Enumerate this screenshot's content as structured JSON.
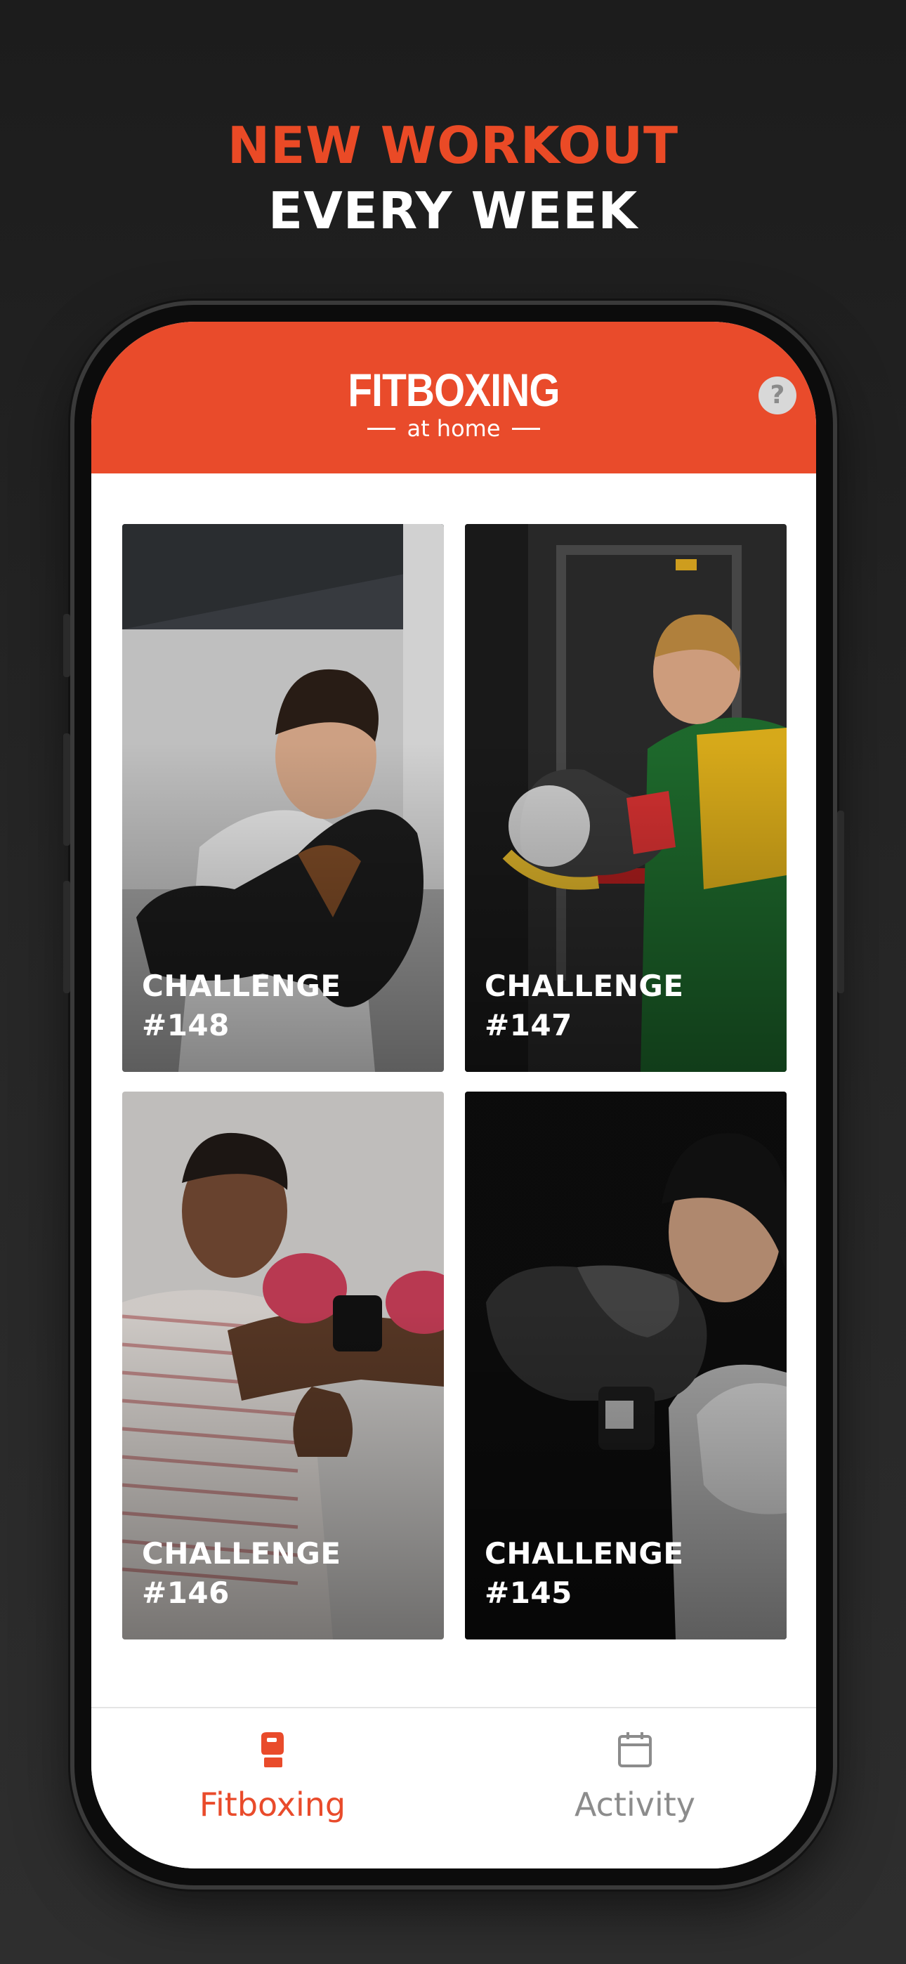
{
  "promo": {
    "headline_line1": "NEW WORKOUT",
    "headline_line2": "EVERY WEEK"
  },
  "app": {
    "logo_main": "FITBOXING",
    "logo_sub": "at home",
    "help_label": "?"
  },
  "challenges": [
    {
      "word": "CHALLENGE",
      "number": "#148"
    },
    {
      "word": "CHALLENGE",
      "number": "#147"
    },
    {
      "word": "CHALLENGE",
      "number": "#146"
    },
    {
      "word": "CHALLENGE",
      "number": "#145"
    }
  ],
  "nav": {
    "items": [
      {
        "label": "Fitboxing",
        "icon": "boxing-glove-icon",
        "active": true
      },
      {
        "label": "Activity",
        "icon": "calendar-icon",
        "active": false
      }
    ]
  },
  "colors": {
    "brand": "#e94b2b",
    "active_nav": "#e94b2b",
    "inactive_nav": "#8c8c8c"
  }
}
